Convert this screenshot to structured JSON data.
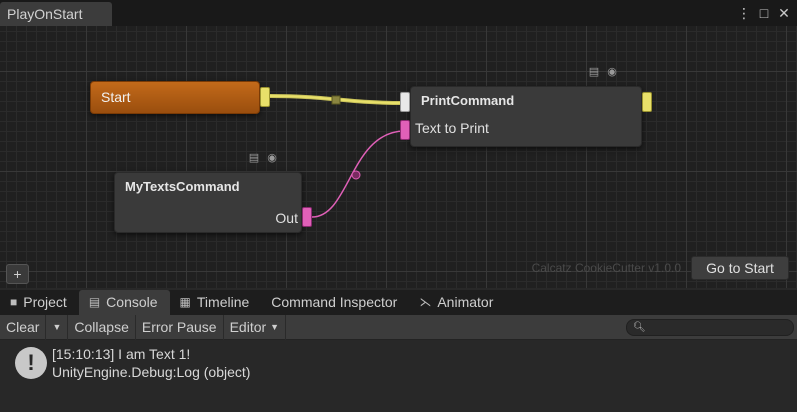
{
  "window": {
    "tab_title": "PlayOnStart",
    "menu_icon": "kebab-menu-icon",
    "maximize_icon": "maximize-icon",
    "close_icon": "close-icon"
  },
  "graph": {
    "nodes": {
      "start": {
        "title": "Start"
      },
      "print": {
        "title": "PrintCommand",
        "input_label": "Text to Print"
      },
      "mytexts": {
        "title": "MyTextsCommand",
        "output_label": "Out"
      }
    },
    "add_button": "+",
    "watermark": "Calcatz CookieCutter v1.0.0",
    "goto_button": "Go to Start",
    "colors": {
      "start_node": "#b35d13",
      "flow_wire": "#e8e06a",
      "data_wire": "#e060b8"
    }
  },
  "bottom_tabs": [
    {
      "label": "Project",
      "icon": "folder-icon"
    },
    {
      "label": "Console",
      "icon": "console-icon"
    },
    {
      "label": "Timeline",
      "icon": "film-icon"
    },
    {
      "label": "Command Inspector",
      "icon": ""
    },
    {
      "label": "Animator",
      "icon": "animator-icon"
    }
  ],
  "console": {
    "toolbar": {
      "clear": "Clear",
      "collapse": "Collapse",
      "error_pause": "Error Pause",
      "editor": "Editor"
    },
    "search": {
      "placeholder": "",
      "value": ""
    },
    "log": {
      "line1": "[15:10:13] I am Text 1!",
      "line2": "UnityEngine.Debug:Log (object)"
    }
  }
}
